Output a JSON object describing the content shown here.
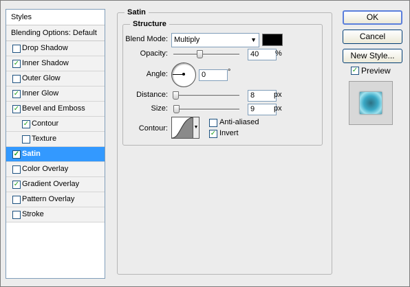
{
  "styles_list": {
    "header": "Styles",
    "blending_default": "Blending Options: Default",
    "items": [
      {
        "label": "Drop Shadow",
        "checked": false,
        "indent": false,
        "selected": false
      },
      {
        "label": "Inner Shadow",
        "checked": true,
        "indent": false,
        "selected": false
      },
      {
        "label": "Outer Glow",
        "checked": false,
        "indent": false,
        "selected": false
      },
      {
        "label": "Inner Glow",
        "checked": true,
        "indent": false,
        "selected": false
      },
      {
        "label": "Bevel and Emboss",
        "checked": true,
        "indent": false,
        "selected": false
      },
      {
        "label": "Contour",
        "checked": true,
        "indent": true,
        "selected": false
      },
      {
        "label": "Texture",
        "checked": false,
        "indent": true,
        "selected": false
      },
      {
        "label": "Satin",
        "checked": true,
        "indent": false,
        "selected": true
      },
      {
        "label": "Color Overlay",
        "checked": false,
        "indent": false,
        "selected": false
      },
      {
        "label": "Gradient Overlay",
        "checked": true,
        "indent": false,
        "selected": false
      },
      {
        "label": "Pattern Overlay",
        "checked": false,
        "indent": false,
        "selected": false
      },
      {
        "label": "Stroke",
        "checked": false,
        "indent": false,
        "selected": false
      }
    ]
  },
  "satin": {
    "title": "Satin",
    "structure_title": "Structure",
    "blend_mode_label": "Blend Mode:",
    "blend_mode_value": "Multiply",
    "blend_color": "#000000",
    "opacity_label": "Opacity:",
    "opacity_value": "40",
    "opacity_unit": "%",
    "opacity_level": 0.4,
    "angle_label": "Angle:",
    "angle_value": "0",
    "angle_unit": "°",
    "distance_label": "Distance:",
    "distance_value": "8",
    "distance_unit": "px",
    "distance_level": 0.03,
    "size_label": "Size:",
    "size_value": "9",
    "size_unit": "px",
    "size_level": 0.04,
    "contour_label": "Contour:",
    "anti_aliased_label": "Anti-aliased",
    "anti_aliased_checked": false,
    "invert_label": "Invert",
    "invert_checked": true
  },
  "buttons": {
    "ok": "OK",
    "cancel": "Cancel",
    "new_style": "New Style..."
  },
  "preview": {
    "label": "Preview",
    "checked": true
  }
}
